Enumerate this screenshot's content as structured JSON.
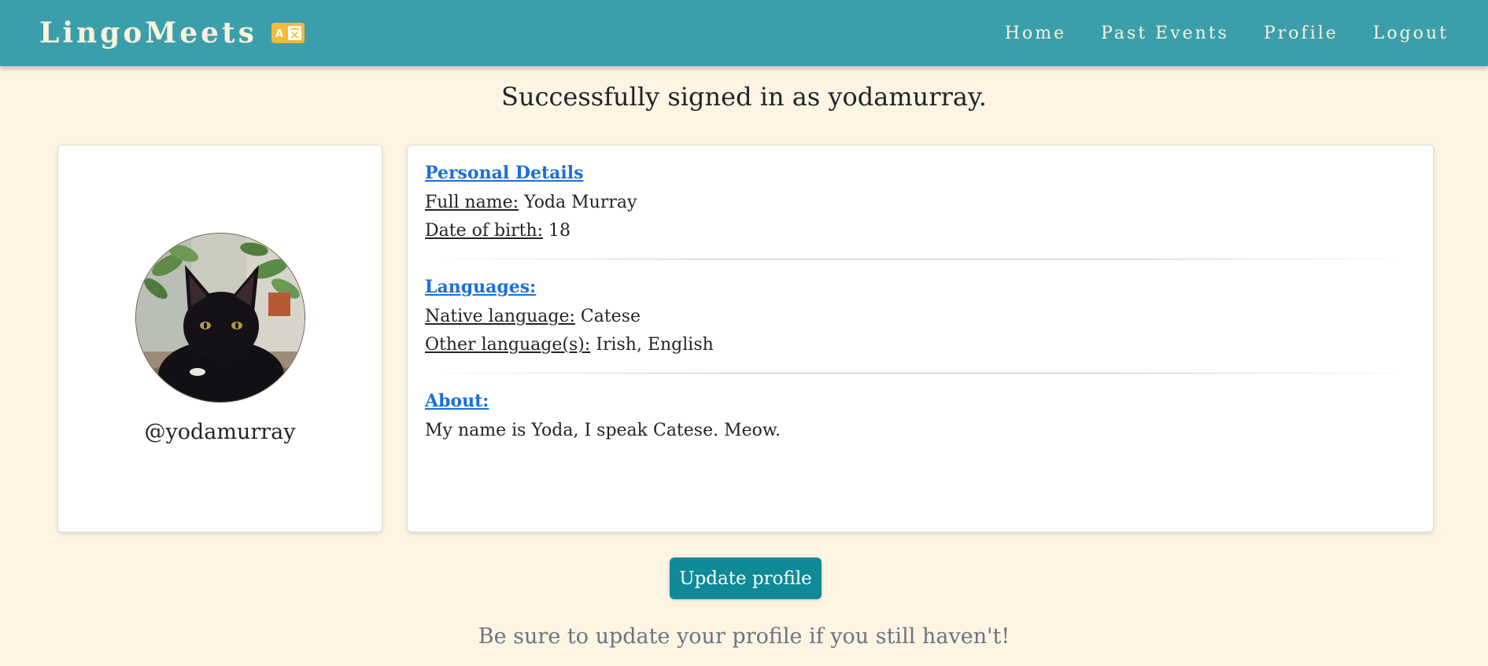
{
  "navbar": {
    "brand": "LingoMeets",
    "brand_icon": "translate-icon",
    "links": [
      {
        "label": "Home"
      },
      {
        "label": "Past Events"
      },
      {
        "label": "Profile"
      },
      {
        "label": "Logout"
      }
    ],
    "bg_color": "#3a9fab"
  },
  "flash_message": "Successfully signed in as yodamurray.",
  "profile_card": {
    "avatar_icon": "cat-avatar-photo",
    "username": "@yodamurray"
  },
  "details": {
    "personal_title": "Personal Details",
    "full_name_label": "Full name:",
    "full_name": "Yoda Murray",
    "dob_label": "Date of birth:",
    "dob": "18",
    "languages_title": "Languages:",
    "native_label": "Native language:",
    "native": "Catese",
    "other_label": "Other language(s):",
    "other": "Irish, English",
    "about_title": "About:",
    "about_text": "My name is Yoda, I speak Catese. Meow."
  },
  "update_button": "Update profile",
  "hint": "Be sure to update your profile if you still haven't!",
  "colors": {
    "page_bg": "#fdf4e4",
    "accent": "#0f8a96",
    "link": "#1a6fdc"
  }
}
